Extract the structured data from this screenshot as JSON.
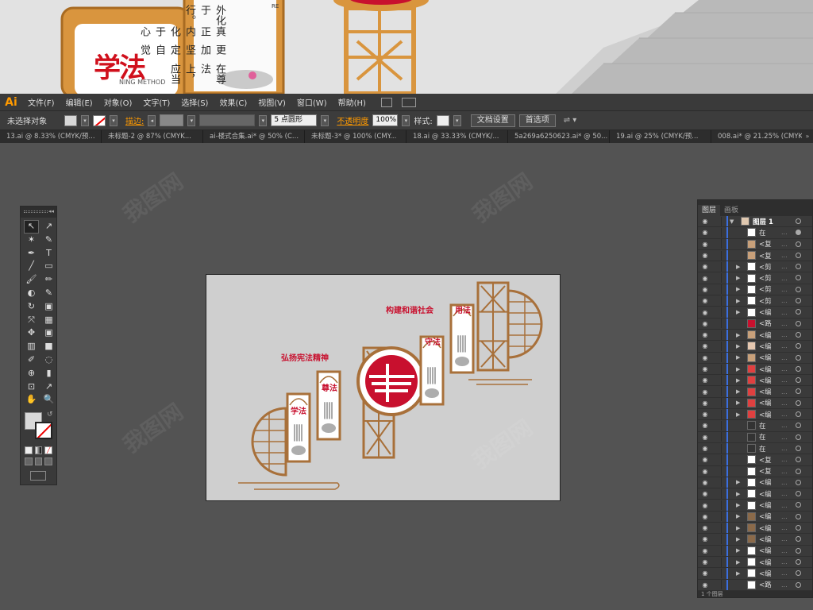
{
  "hero": {
    "panel_left_title": "学法",
    "panel_left_sub": "NING METHOD",
    "panel_right_lines": [
      "在尊法上，应当",
      "更加坚定自觉",
      "真正内化于心",
      "外化于行。"
    ],
    "panel_right_corner": "RE"
  },
  "app": {
    "logo": "Ai",
    "menu": [
      "文件(F)",
      "编辑(E)",
      "对象(O)",
      "文字(T)",
      "选择(S)",
      "效果(C)",
      "视图(V)",
      "窗口(W)",
      "帮助(H)"
    ],
    "control": {
      "selection_label": "未选择对象",
      "stroke_label": "描边:",
      "brush_value": "5 点圆形",
      "opacity_label": "不透明度",
      "opacity_value": "100%",
      "style_label": "样式:",
      "doc_setup": "文档设置",
      "preferences": "首选项"
    },
    "tabs": [
      "13.ai @ 8.33% (CMYK/预...",
      "未标题-2 @ 87% (CMYK...",
      "ai-楼式合集.ai* @ 50% (C...",
      "未标题-3* @ 100% (CMY...",
      "18.ai @ 33.33% (CMYK/...",
      "5a269a6250623.ai* @ 50...",
      "19.ai @ 25% (CMYK/预...",
      "008.ai* @ 21.25% (CMYK/..."
    ],
    "tab_overflow": "»",
    "toolbox_collapse": "◂◂",
    "tools": [
      [
        "↖",
        "↗"
      ],
      [
        "✶",
        "✎"
      ],
      [
        "✒",
        "T"
      ],
      [
        "╱",
        "▭"
      ],
      [
        "🖌",
        "✏"
      ],
      [
        "◐",
        "✎"
      ],
      [
        "↻",
        "▣"
      ],
      [
        "⤧",
        "▦"
      ],
      [
        "✥",
        "▣"
      ],
      [
        "▥",
        "■"
      ],
      [
        "✐",
        "◌"
      ],
      [
        "⊕",
        "▮"
      ],
      [
        "⊡",
        "↗"
      ],
      [
        "✋",
        "🔍"
      ]
    ]
  },
  "artboard": {
    "slogan_left": "弘扬宪法精神",
    "slogan_right": "构建和谐社会",
    "panels": [
      "学法",
      "尊法",
      "守法",
      "用法"
    ]
  },
  "layers": {
    "tabs": [
      "图层",
      "画板"
    ],
    "layer_name": "图层 1",
    "footer": "1 个图层",
    "items": [
      {
        "name": "在",
        "dots": "...",
        "arrow": false,
        "thumb": "#ffffff",
        "target": true
      },
      {
        "name": "<复",
        "dots": "...",
        "arrow": false,
        "thumb": "#c8a07a",
        "target": false
      },
      {
        "name": "<复",
        "dots": "...",
        "arrow": false,
        "thumb": "#c8a07a",
        "target": false
      },
      {
        "name": "<剪",
        "dots": "...",
        "arrow": true,
        "thumb": "#ffffff",
        "target": false
      },
      {
        "name": "<剪",
        "dots": "...",
        "arrow": true,
        "thumb": "#ffffff",
        "target": false
      },
      {
        "name": "<剪",
        "dots": "...",
        "arrow": true,
        "thumb": "#ffffff",
        "target": false
      },
      {
        "name": "<剪",
        "dots": "...",
        "arrow": true,
        "thumb": "#ffffff",
        "target": false
      },
      {
        "name": "<编",
        "dots": "...",
        "arrow": true,
        "thumb": "#ffffff",
        "target": false
      },
      {
        "name": "<路",
        "dots": "...",
        "arrow": false,
        "thumb": "#c8102e",
        "target": false
      },
      {
        "name": "<编",
        "dots": "...",
        "arrow": true,
        "thumb": "#c8a07a",
        "target": false
      },
      {
        "name": "<编",
        "dots": "...",
        "arrow": true,
        "thumb": "#e6c8b0",
        "target": false
      },
      {
        "name": "<编",
        "dots": "...",
        "arrow": true,
        "thumb": "#c8a07a",
        "target": false
      },
      {
        "name": "<编",
        "dots": "...",
        "arrow": true,
        "thumb": "#e04040",
        "target": false
      },
      {
        "name": "<编",
        "dots": "...",
        "arrow": true,
        "thumb": "#e04040",
        "target": false
      },
      {
        "name": "<编",
        "dots": "...",
        "arrow": true,
        "thumb": "#e04040",
        "target": false
      },
      {
        "name": "<编",
        "dots": "...",
        "arrow": true,
        "thumb": "#e04040",
        "target": false
      },
      {
        "name": "<编",
        "dots": "...",
        "arrow": true,
        "thumb": "#e04040",
        "target": false
      },
      {
        "name": "在",
        "dots": "...",
        "arrow": false,
        "thumb": "#333333",
        "target": false
      },
      {
        "name": "在",
        "dots": "...",
        "arrow": false,
        "thumb": "#333333",
        "target": false
      },
      {
        "name": "在",
        "dots": "...",
        "arrow": false,
        "thumb": "#333333",
        "target": false
      },
      {
        "name": "<复",
        "dots": "...",
        "arrow": false,
        "thumb": "#ffffff",
        "target": false
      },
      {
        "name": "<复",
        "dots": "...",
        "arrow": false,
        "thumb": "#ffffff",
        "target": false
      },
      {
        "name": "<编",
        "dots": "...",
        "arrow": true,
        "thumb": "#ffffff",
        "target": false
      },
      {
        "name": "<编",
        "dots": "...",
        "arrow": true,
        "thumb": "#ffffff",
        "target": false
      },
      {
        "name": "<编",
        "dots": "...",
        "arrow": true,
        "thumb": "#ffffff",
        "target": false
      },
      {
        "name": "<编",
        "dots": "...",
        "arrow": true,
        "thumb": "#8b6a4a",
        "target": false
      },
      {
        "name": "<编",
        "dots": "...",
        "arrow": true,
        "thumb": "#8b6a4a",
        "target": false
      },
      {
        "name": "<编",
        "dots": "...",
        "arrow": true,
        "thumb": "#8b6a4a",
        "target": false
      },
      {
        "name": "<编",
        "dots": "...",
        "arrow": true,
        "thumb": "#ffffff",
        "target": false
      },
      {
        "name": "<编",
        "dots": "...",
        "arrow": true,
        "thumb": "#ffffff",
        "target": false
      },
      {
        "name": "<编",
        "dots": "...",
        "arrow": true,
        "thumb": "#ffffff",
        "target": false
      },
      {
        "name": "<路",
        "dots": "...",
        "arrow": false,
        "thumb": "#ffffff",
        "target": false
      },
      {
        "name": "<编",
        "dots": "...",
        "arrow": true,
        "thumb": "#ffffff",
        "target": false
      },
      {
        "name": "<路",
        "dots": "...",
        "arrow": false,
        "thumb": "#ffffff",
        "target": false
      }
    ]
  },
  "colors": {
    "wood": "#a8703a",
    "red": "#c8102e",
    "accent": "#ff9a00"
  }
}
